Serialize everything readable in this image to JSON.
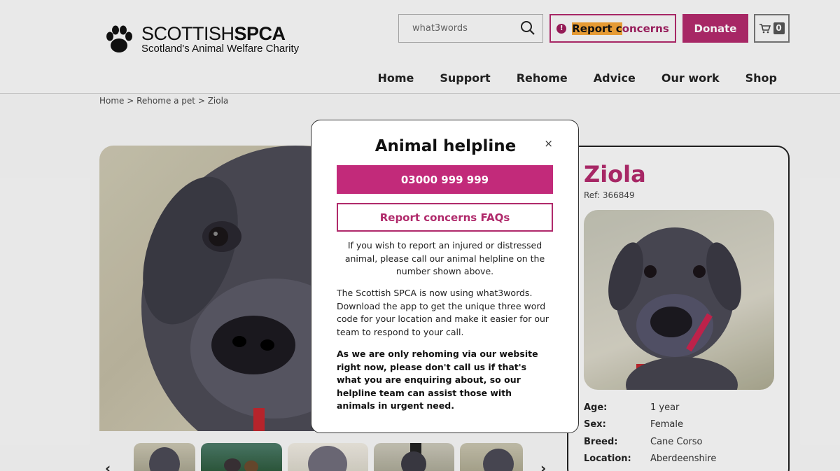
{
  "header": {
    "logo_name_light": "SCOTTISH",
    "logo_name_bold": "SPCA",
    "logo_tagline": "Scotland's Animal Welfare Charity",
    "search_value": "what3words",
    "report_label_pre": "Report",
    "report_label_hl": " c",
    "report_label_post": "oncerns",
    "donate_label": "Donate",
    "cart_count": "0"
  },
  "nav": {
    "items": [
      {
        "label": "Home"
      },
      {
        "label": "Support"
      },
      {
        "label": "Rehome"
      },
      {
        "label": "Advice"
      },
      {
        "label": "Our work"
      },
      {
        "label": "Shop"
      }
    ]
  },
  "breadcrumb": {
    "home": "Home",
    "sep1": " > ",
    "rehome": "Rehome a pet",
    "sep2": " > ",
    "current": "Ziola"
  },
  "pet": {
    "name": "Ziola",
    "ref": "Ref: 366849",
    "facts": [
      {
        "label": "Age:",
        "value": "1 year"
      },
      {
        "label": "Sex:",
        "value": "Female"
      },
      {
        "label": "Breed:",
        "value": "Cane Corso"
      },
      {
        "label": "Location:",
        "value": "Aberdeenshire"
      }
    ]
  },
  "thumbs": {
    "prev": "‹",
    "next": "›"
  },
  "modal": {
    "title": "Animal helpline",
    "close": "×",
    "phone": "03000 999 999",
    "faq": "Report concerns FAQs",
    "p1": "If you wish to report an injured or distressed animal, please call our animal helpline on the number shown above.",
    "p2": "The Scottish SPCA is now using what3words. Download the app to get the unique three word code for your location and make it easier for our team to respond to your call.",
    "p3": "As we are only rehoming via our website right now, please don't call us if that's what you are enquiring about, so our helpline team can assist those with animals in urgent need."
  },
  "colors": {
    "brand": "#b02a6b",
    "phone_button": "#c22a7a",
    "highlight": "#f3a437"
  }
}
